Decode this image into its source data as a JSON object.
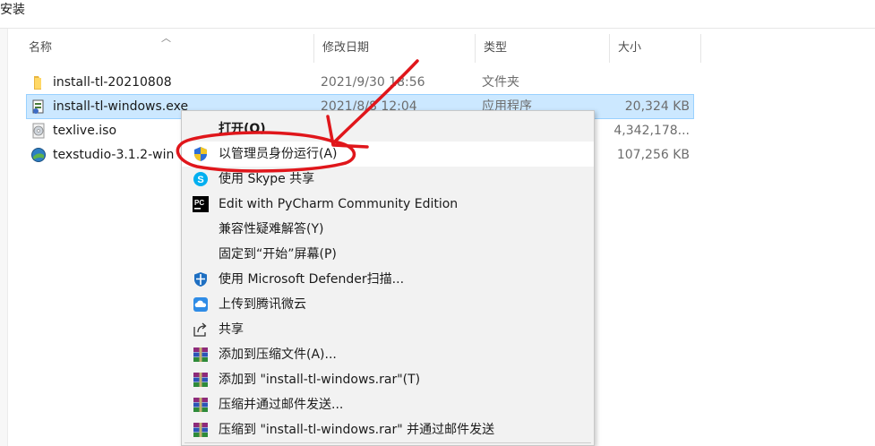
{
  "window": {
    "title": "安装"
  },
  "columns": {
    "name": "名称",
    "date": "修改日期",
    "type": "类型",
    "size": "大小"
  },
  "files": [
    {
      "name": "install-tl-20210808",
      "date": "2021/9/30 18:56",
      "type": "文件夹",
      "size": "",
      "icon": "folder-icon"
    },
    {
      "name": "install-tl-windows.exe",
      "date": "2021/8/8 12:04",
      "type": "应用程序",
      "size": "20,324 KB",
      "icon": "installer-exe-icon"
    },
    {
      "name": "texlive.iso",
      "date": "",
      "type": "",
      "size": "4,342,178...",
      "icon": "disc-image-icon"
    },
    {
      "name": "texstudio-3.1.2-win",
      "date": "",
      "type": "",
      "size": "107,256 KB",
      "icon": "texstudio-icon"
    }
  ],
  "context_menu": {
    "items": [
      {
        "label": "打开(O)",
        "icon": "",
        "bold": true
      },
      {
        "label": "以管理员身份运行(A)",
        "icon": "uac-shield-icon",
        "highlighted": true
      },
      {
        "label": "使用 Skype 共享",
        "icon": "skype-icon"
      },
      {
        "label": "Edit with PyCharm Community Edition",
        "icon": "pycharm-icon"
      },
      {
        "label": "兼容性疑难解答(Y)",
        "icon": ""
      },
      {
        "label": "固定到“开始”屏幕(P)",
        "icon": ""
      },
      {
        "label": "使用 Microsoft Defender扫描...",
        "icon": "defender-shield-icon"
      },
      {
        "label": "上传到腾讯微云",
        "icon": "weiyun-cloud-icon"
      },
      {
        "label": "共享",
        "icon": "share-icon"
      },
      {
        "label": "添加到压缩文件(A)...",
        "icon": "winrar-icon"
      },
      {
        "label": "添加到 \"install-tl-windows.rar\"(T)",
        "icon": "winrar-icon"
      },
      {
        "label": "压缩并通过邮件发送...",
        "icon": "winrar-icon"
      },
      {
        "label": "压缩到 \"install-tl-windows.rar\" 并通过邮件发送",
        "icon": "winrar-icon"
      }
    ]
  },
  "colors": {
    "selection_bg": "#cce8ff",
    "menu_bg": "#f2f2f2",
    "annotation_red": "#e0161b"
  }
}
